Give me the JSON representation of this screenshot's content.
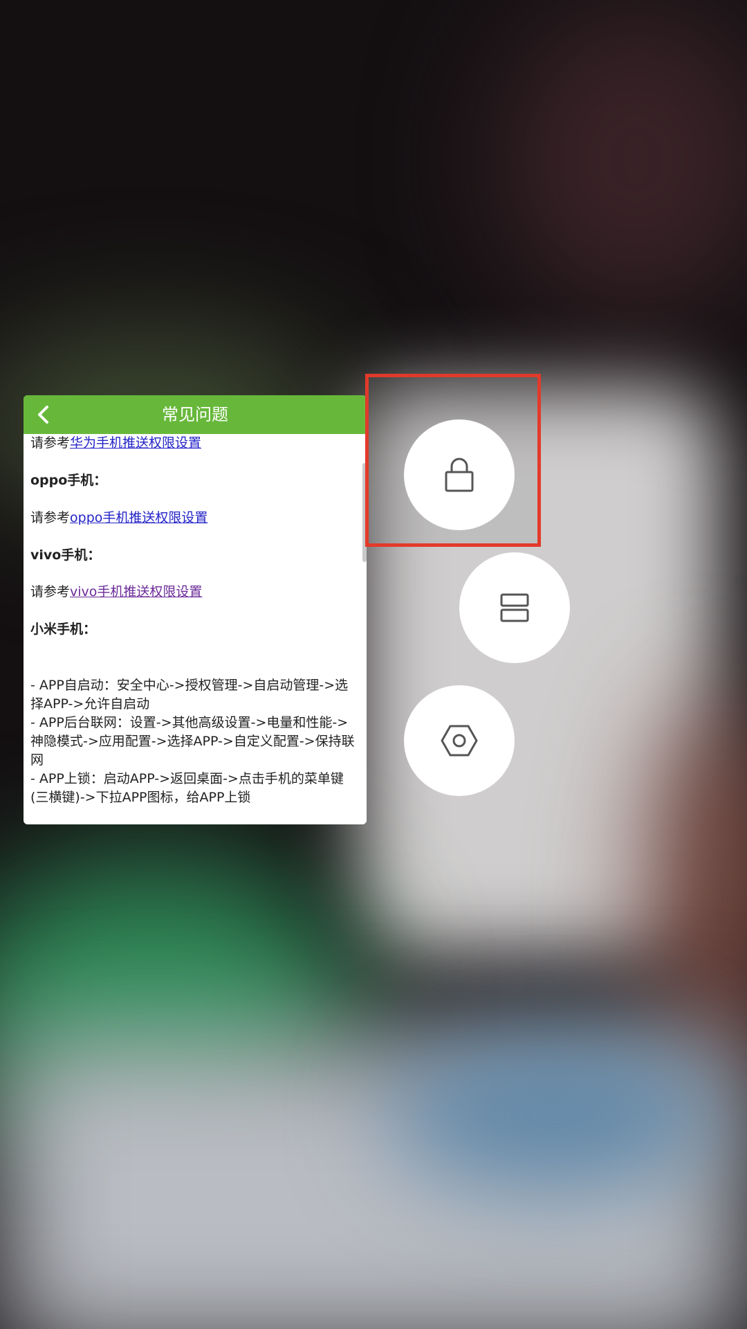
{
  "app_card": {
    "title": "常见问题",
    "content": {
      "huawei_prefix": "请参考",
      "huawei_link": "华为手机推送权限设置",
      "oppo_heading": "oppo手机：",
      "oppo_prefix": "请参考",
      "oppo_link": "oppo手机推送权限设置",
      "vivo_heading": "vivo手机：",
      "vivo_prefix": "请参考",
      "vivo_link": "vivo手机推送权限设置",
      "xiaomi_heading": "小米手机：",
      "xiaomi_line1": "- APP自启动：安全中心->授权管理->自启动管理->选择APP->允许自启动",
      "xiaomi_line2": "- APP后台联网：设置->其他高级设置->电量和性能->神隐模式->应用配置->选择APP->自定义配置->保持联网",
      "xiaomi_line3": "- APP上锁：启动APP->返回桌面->点击手机的菜单键(三横键)->下拉APP图标，给APP上锁"
    }
  },
  "actions": [
    {
      "name": "lock",
      "icon": "lock-icon"
    },
    {
      "name": "split-screen",
      "icon": "split-screen-icon"
    },
    {
      "name": "settings",
      "icon": "hexagon-settings-icon"
    }
  ],
  "colors": {
    "header_green": "#67b83a",
    "link_blue": "#2323c8",
    "link_visited": "#6b2a99",
    "highlight_red": "#e23a2a"
  }
}
